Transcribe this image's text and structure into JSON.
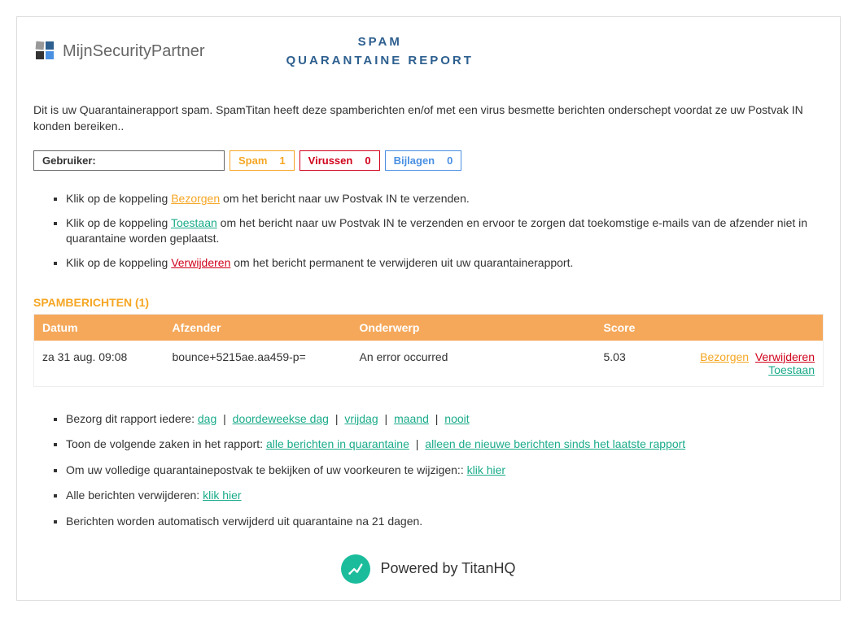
{
  "logo_text": "MijnSecurityPartner",
  "title_line1": "SPAM",
  "title_line2": "QUARANTAINE REPORT",
  "intro": "Dit is uw Quarantainerapport spam. SpamTitan heeft deze spamberichten en/of met een virus besmette berichten onderschept voordat ze uw Postvak IN konden bereiken..",
  "stats": {
    "user_label": "Gebruiker:",
    "spam_label": "Spam",
    "spam_count": "1",
    "virus_label": "Virussen",
    "virus_count": "0",
    "attach_label": "Bijlagen",
    "attach_count": "0"
  },
  "instructions": {
    "i1_prefix": "Klik op de koppeling ",
    "i1_link": "Bezorgen",
    "i1_suffix": " om het bericht naar uw Postvak IN te verzenden.",
    "i2_prefix": "Klik op de koppeling ",
    "i2_link": "Toestaan",
    "i2_suffix": " om het bericht naar uw Postvak IN te verzenden en ervoor te zorgen dat toekomstige e-mails van de afzender niet in quarantaine worden geplaatst.",
    "i3_prefix": "Klik op de koppeling ",
    "i3_link": "Verwijderen",
    "i3_suffix": " om het bericht permanent te verwijderen uit uw quarantainerapport."
  },
  "section_title": "SPAMBERICHTEN (1)",
  "table": {
    "h_date": "Datum",
    "h_sender": "Afzender",
    "h_subject": "Onderwerp",
    "h_score": "Score",
    "rows": [
      {
        "date": "za 31 aug. 09:08",
        "sender": "bounce+5215ae.aa459-p=",
        "subject": "An error occurred",
        "score": "5.03",
        "a_deliver": "Bezorgen",
        "a_delete": "Verwijderen",
        "a_allow": "Toestaan"
      }
    ]
  },
  "footer": {
    "f1_prefix": "Bezorg dit rapport iedere: ",
    "f1_opt1": "dag",
    "f1_opt2": "doordeweekse dag",
    "f1_opt3": "vrijdag",
    "f1_opt4": "maand",
    "f1_opt5": "nooit",
    "f2_prefix": "Toon de volgende zaken in het rapport: ",
    "f2_opt1": "alle berichten in quarantaine",
    "f2_opt2": "alleen de nieuwe berichten sinds het laatste rapport",
    "f3_prefix": "Om uw volledige quarantainepostvak te bekijken of uw voorkeuren te wijzigen:: ",
    "f3_link": "klik hier",
    "f4_prefix": "Alle berichten verwijderen: ",
    "f4_link": "klik hier",
    "f5": "Berichten worden automatisch verwijderd uit quarantaine na 21 dagen."
  },
  "powered": "Powered by TitanHQ"
}
